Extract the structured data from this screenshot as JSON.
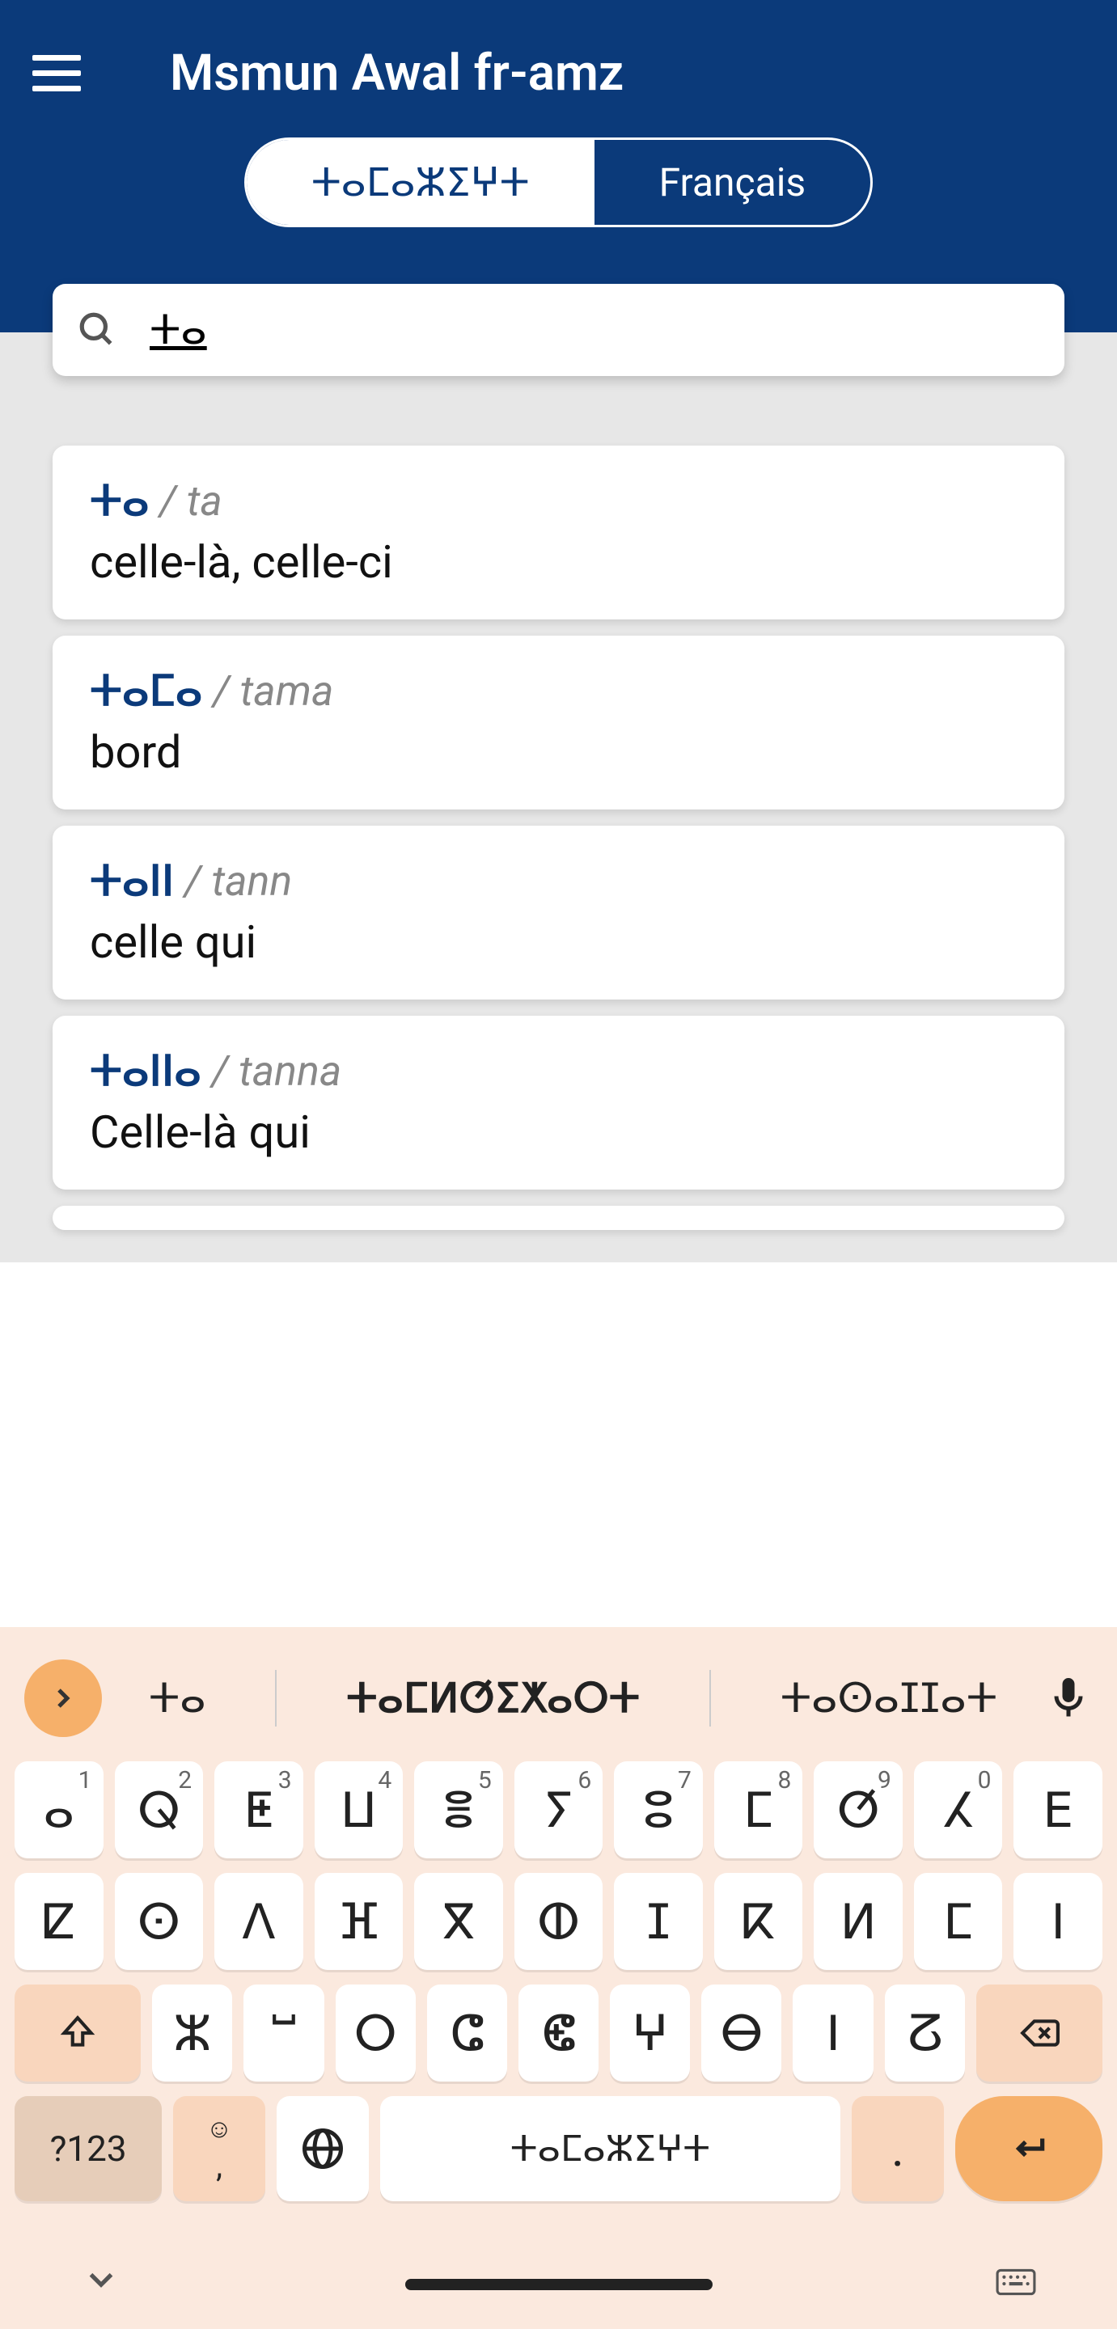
{
  "header": {
    "title": "Msmun Awal fr-amz",
    "tabs": {
      "active": "ⵜⴰⵎⴰⵣⵉⵖⵜ",
      "inactive": "Français"
    }
  },
  "search": {
    "value": "ⵜⴰ"
  },
  "results": [
    {
      "term": "ⵜⴰ",
      "sep": " / ",
      "translit": "ta",
      "def": "celle-là, celle-ci"
    },
    {
      "term": "ⵜⴰⵎⴰ",
      "sep": " / ",
      "translit": "tama",
      "def": "bord"
    },
    {
      "term": "ⵜⴰⵏⵏ",
      "sep": " / ",
      "translit": "tann",
      "def": "celle qui"
    },
    {
      "term": "ⵜⴰⵏⵏⴰ",
      "sep": " / ",
      "translit": "tanna",
      "def": "Celle-là qui"
    }
  ],
  "keyboard": {
    "suggestions": [
      "ⵜⴰ",
      "ⵜⴰⵎⵍⵚⵉⵅⴰⵔⵜ",
      "ⵜⴰⵙⴰⵊⵊⴰⵜ"
    ],
    "row1": [
      {
        "c": "ⴰ",
        "h": "1"
      },
      {
        "c": "ⵕ",
        "h": "2"
      },
      {
        "c": "ⵟ",
        "h": "3"
      },
      {
        "c": "ⵡ",
        "h": "4"
      },
      {
        "c": "ⴻ",
        "h": "5"
      },
      {
        "c": "ⵢ",
        "h": "6"
      },
      {
        "c": "ⵓ",
        "h": "7"
      },
      {
        "c": "ⵎ",
        "h": "8"
      },
      {
        "c": "ⵚ",
        "h": "9"
      },
      {
        "c": "ⵃ",
        "h": "0"
      },
      {
        "c": "ⴹ",
        "h": ""
      }
    ],
    "row2": [
      {
        "c": "ⵇ"
      },
      {
        "c": "ⵙ"
      },
      {
        "c": "ⴷ"
      },
      {
        "c": "ⴼ"
      },
      {
        "c": "ⴳ"
      },
      {
        "c": "ⵀ"
      },
      {
        "c": "ⵊ"
      },
      {
        "c": "ⴽ"
      },
      {
        "c": "ⵍ"
      },
      {
        "c": "ⵎ"
      },
      {
        "c": "ⵏ"
      }
    ],
    "row3": [
      {
        "c": "ⵣ"
      },
      {
        "c": "ⵯ"
      },
      {
        "c": "ⵔ"
      },
      {
        "c": "ⵛ"
      },
      {
        "c": "ⵞ"
      },
      {
        "c": "ⵖ"
      },
      {
        "c": "ⴱ"
      },
      {
        "c": "ⵏ"
      },
      {
        "c": "ⵒ"
      }
    ],
    "bottom": {
      "num": "?123",
      "comma": ",",
      "space": "ⵜⴰⵎⴰⵣⵉⵖⵜ",
      "dot": "."
    }
  }
}
